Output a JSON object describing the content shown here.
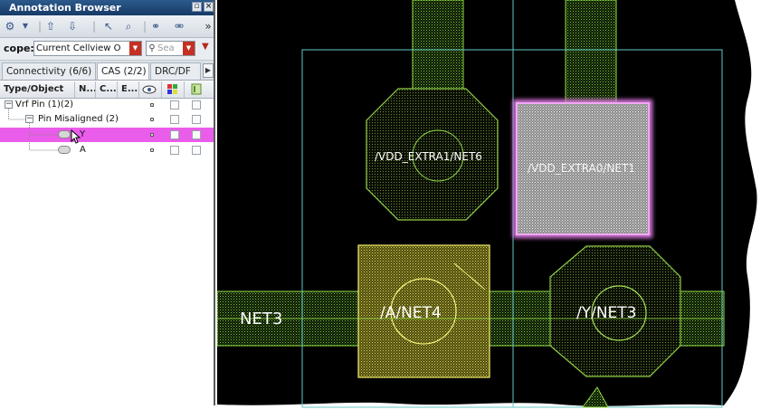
{
  "window": {
    "title": "Annotation Browser",
    "buttons": [
      "restore-icon",
      "close-icon"
    ]
  },
  "toolbar": {
    "icons": [
      "settings-icon",
      "up-arrow-icon",
      "down-arrow-icon",
      "select-icon",
      "zoom-icon",
      "link-icon",
      "unlink-icon",
      "overflow-icon"
    ],
    "overflow_label": "»"
  },
  "scope": {
    "label": "cope:",
    "value": "Current Cellview O",
    "search_placeholder": "Sea"
  },
  "tabs": [
    {
      "label": "Connectivity (6/6)",
      "active": false
    },
    {
      "label": "CAS (2/2)",
      "active": true
    },
    {
      "label": "DRC/DF",
      "active": false
    }
  ],
  "columns": {
    "type_object": "Type/Object",
    "n": "N...",
    "c": "C...",
    "e": "E...",
    "icons": [
      "eye-icon",
      "color-grid-icon",
      "layer-icon"
    ]
  },
  "tree": [
    {
      "label": "Vrf Pin (1)(2)",
      "level": 0,
      "selected": false
    },
    {
      "label": "Pin Misaligned (2)",
      "level": 1,
      "selected": false
    },
    {
      "label": "Y",
      "level": 2,
      "selected": true
    },
    {
      "label": "A",
      "level": 2,
      "selected": false
    }
  ],
  "layout": {
    "net_labels": [
      {
        "id": "vdd-extra1",
        "text": "/VDD_EXTRA1/NET6"
      },
      {
        "id": "vdd-extra0",
        "text": "/VDD_EXTRA0/NET1"
      },
      {
        "id": "net3",
        "text": "NET3"
      },
      {
        "id": "a-net4",
        "text": "/A/NET4"
      },
      {
        "id": "y-net3",
        "text": "/Y/NET3"
      }
    ],
    "colors": {
      "background": "#000000",
      "metal_green": "#7fcf3a",
      "highlight_yellow": "#d8d64a",
      "selection_magenta": "#e27be6",
      "boundary_cyan": "#63c7c7"
    }
  }
}
